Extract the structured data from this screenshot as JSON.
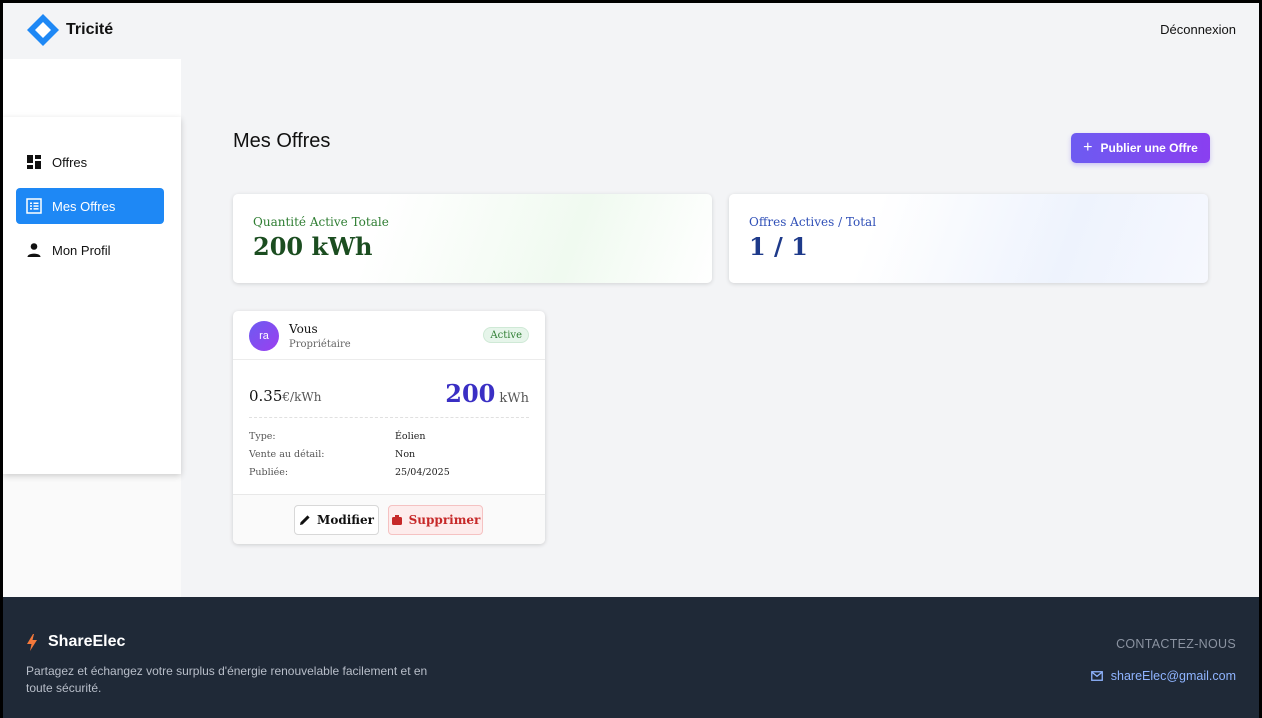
{
  "header": {
    "brand": "Tricité",
    "logout_label": "Déconnexion"
  },
  "sidebar": {
    "items": [
      {
        "label": "Offres",
        "icon": "dashboard-icon",
        "active": false
      },
      {
        "label": "Mes Offres",
        "icon": "list-icon",
        "active": true
      },
      {
        "label": "Mon Profil",
        "icon": "person-icon",
        "active": false
      }
    ]
  },
  "main": {
    "title": "Mes Offres",
    "publish_button": "Publier une Offre",
    "stats": [
      {
        "label": "Quantité Active Totale",
        "value": "200 kWh",
        "color": "#2e7d32"
      },
      {
        "label": "Offres Actives / Total",
        "value": "1 / 1",
        "color": "#2f4fb7"
      }
    ],
    "offer": {
      "avatar": "ra",
      "owner": "Vous",
      "role": "Propriétaire",
      "status": "Active",
      "price": "0.35",
      "price_unit": "€/kWh",
      "quantity": "200",
      "quantity_unit": "kWh",
      "details": {
        "type_label": "Type:",
        "type_value": "Éolien",
        "retail_label": "Vente au détail:",
        "retail_value": "Non",
        "published_label": "Publiée:",
        "published_value": "25/04/2025"
      },
      "edit_button": "Modifier",
      "delete_button": "Supprimer"
    }
  },
  "footer": {
    "brand": "ShareElec",
    "description": "Partagez et échangez votre surplus d'énergie renouvelable facilement et en toute sécurité.",
    "contact_title": "CONTACTEZ-NOUS",
    "email": "shareElec@gmail.com"
  },
  "colors": {
    "accent": "#1e88f5",
    "publish_gradient_start": "#6d5bf1",
    "publish_gradient_end": "#8a3ff0",
    "footer_bg": "#1f2937",
    "danger": "#c62828"
  }
}
